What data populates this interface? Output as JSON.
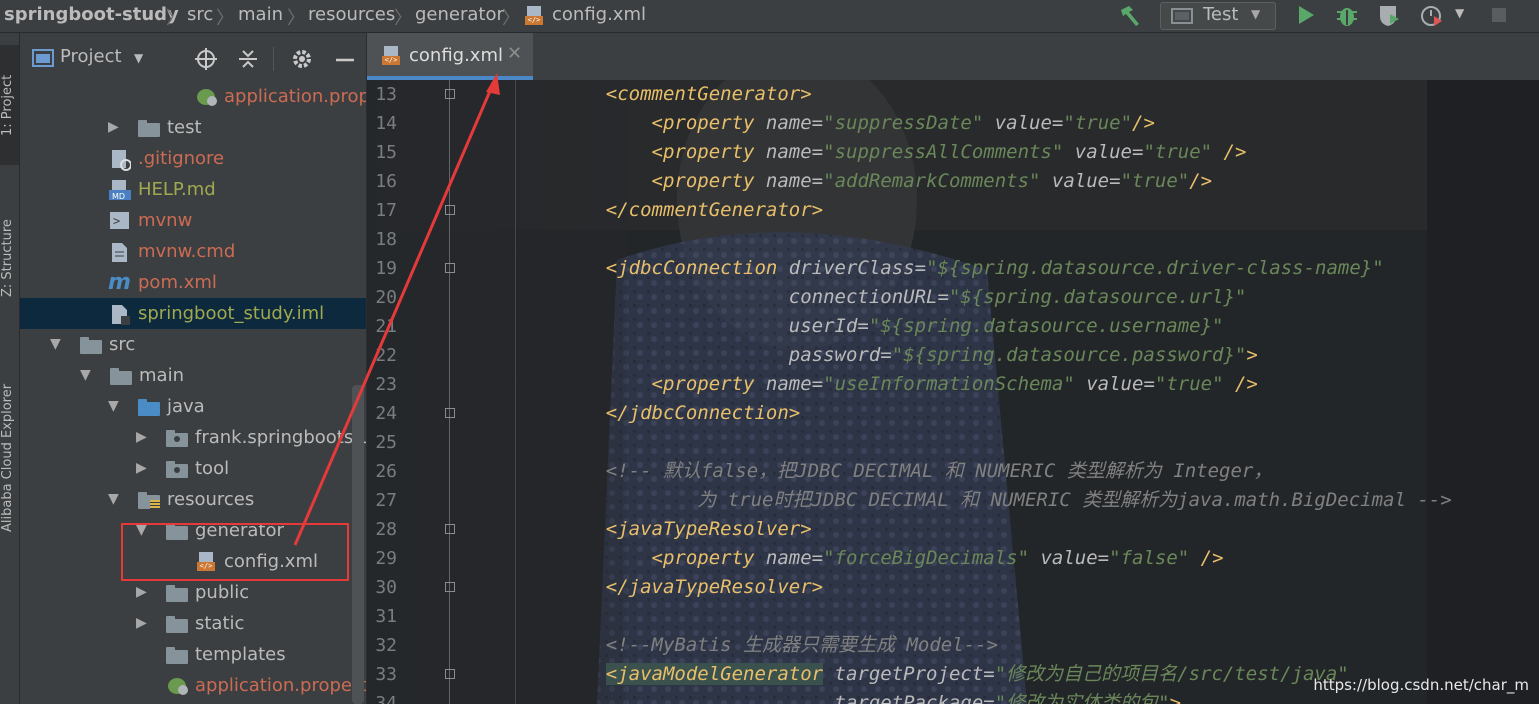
{
  "breadcrumb": {
    "items": [
      "springboot-study",
      "src",
      "main",
      "resources",
      "generator",
      "config.xml"
    ]
  },
  "toolbar": {
    "run_config_label": "Test",
    "icons": [
      "build-hammer-icon",
      "run-icon",
      "debug-icon",
      "coverage-icon",
      "profile-icon",
      "stop-icon"
    ]
  },
  "left_strip": {
    "tabs": [
      "1: Project",
      "Z: Structure",
      "Alibaba Cloud Explorer"
    ]
  },
  "project_panel": {
    "title": "Project",
    "tree": [
      {
        "label": "application.prope",
        "icon": "spring-properties-icon",
        "color": "#cc6b53"
      },
      {
        "label": "test",
        "icon": "folder-icon",
        "color": "#bbbbbb",
        "arrow": "▶"
      },
      {
        "label": ".gitignore",
        "icon": "file-ignore-icon",
        "color": "#cc6b53"
      },
      {
        "label": "HELP.md",
        "icon": "markdown-icon",
        "color": "#a0a94f"
      },
      {
        "label": "mvnw",
        "icon": "shell-script-icon",
        "color": "#cc6b53"
      },
      {
        "label": "mvnw.cmd",
        "icon": "file-icon",
        "color": "#cc6b53"
      },
      {
        "label": "pom.xml",
        "icon": "maven-icon",
        "color": "#cc6b53"
      },
      {
        "label": "springboot_study.iml",
        "icon": "iml-file-icon",
        "color": "#a0a94f"
      },
      {
        "label": "src",
        "icon": "folder-icon",
        "color": "#bbbbbb",
        "arrow": "▼"
      },
      {
        "label": "main",
        "icon": "folder-icon",
        "color": "#bbbbbb",
        "arrow": "▼"
      },
      {
        "label": "java",
        "icon": "source-folder-icon",
        "color": "#bbbbbb",
        "arrow": "▼"
      },
      {
        "label": "frank.springbootstuc",
        "icon": "package-icon",
        "color": "#bbbbbb",
        "arrow": "▶"
      },
      {
        "label": "tool",
        "icon": "package-icon",
        "color": "#bbbbbb",
        "arrow": "▶"
      },
      {
        "label": "resources",
        "icon": "resources-folder-icon",
        "color": "#bbbbbb",
        "arrow": "▼"
      },
      {
        "label": "generator",
        "icon": "folder-icon",
        "color": "#bbbbbb",
        "arrow": "▼"
      },
      {
        "label": "config.xml",
        "icon": "xml-file-icon",
        "color": "#bbbbbb"
      },
      {
        "label": "public",
        "icon": "folder-icon",
        "color": "#bbbbbb",
        "arrow": "▶"
      },
      {
        "label": "static",
        "icon": "folder-icon",
        "color": "#bbbbbb",
        "arrow": "▶"
      },
      {
        "label": "templates",
        "icon": "folder-icon",
        "color": "#bbbbbb"
      },
      {
        "label": "application.propertie",
        "icon": "spring-properties-icon",
        "color": "#cc6b53"
      }
    ]
  },
  "editor": {
    "tab_label": "config.xml",
    "lines": [
      {
        "n": "13",
        "segs": [
          [
            "    ",
            ""
          ],
          [
            "<commentGenerator>",
            "tag"
          ]
        ]
      },
      {
        "n": "14",
        "segs": [
          [
            "        ",
            ""
          ],
          [
            "<property ",
            "tag"
          ],
          [
            "name",
            "attr"
          ],
          [
            "=",
            "eq"
          ],
          [
            "\"suppressDate\"",
            "val"
          ],
          [
            " value",
            "attr"
          ],
          [
            "=",
            "eq"
          ],
          [
            "\"true\"",
            "val"
          ],
          [
            "/>",
            "tag"
          ]
        ]
      },
      {
        "n": "15",
        "segs": [
          [
            "        ",
            ""
          ],
          [
            "<property ",
            "tag"
          ],
          [
            "name",
            "attr"
          ],
          [
            "=",
            "eq"
          ],
          [
            "\"suppressAllComments\"",
            "val"
          ],
          [
            " value",
            "attr"
          ],
          [
            "=",
            "eq"
          ],
          [
            "\"true\"",
            "val"
          ],
          [
            " />",
            "tag"
          ]
        ]
      },
      {
        "n": "16",
        "segs": [
          [
            "        ",
            ""
          ],
          [
            "<property ",
            "tag"
          ],
          [
            "name",
            "attr"
          ],
          [
            "=",
            "eq"
          ],
          [
            "\"addRemarkComments\"",
            "val"
          ],
          [
            " value",
            "attr"
          ],
          [
            "=",
            "eq"
          ],
          [
            "\"true\"",
            "val"
          ],
          [
            "/>",
            "tag"
          ]
        ]
      },
      {
        "n": "17",
        "segs": [
          [
            "    ",
            ""
          ],
          [
            "</commentGenerator>",
            "tag"
          ]
        ]
      },
      {
        "n": "18",
        "segs": [
          [
            "",
            ""
          ]
        ]
      },
      {
        "n": "19",
        "segs": [
          [
            "    ",
            ""
          ],
          [
            "<jdbcConnection ",
            "tag"
          ],
          [
            "driverClass",
            "attr"
          ],
          [
            "=",
            "eq"
          ],
          [
            "\"${spring.datasource.driver-class-name}\"",
            "val"
          ]
        ]
      },
      {
        "n": "20",
        "segs": [
          [
            "                    ",
            ""
          ],
          [
            "connectionURL",
            "attr"
          ],
          [
            "=",
            "eq"
          ],
          [
            "\"${spring.datasource.url}\"",
            "val"
          ]
        ]
      },
      {
        "n": "21",
        "segs": [
          [
            "                    ",
            ""
          ],
          [
            "userId",
            "attr"
          ],
          [
            "=",
            "eq"
          ],
          [
            "\"${spring.datasource.username}\"",
            "val"
          ]
        ]
      },
      {
        "n": "22",
        "segs": [
          [
            "                    ",
            ""
          ],
          [
            "password",
            "attr"
          ],
          [
            "=",
            "eq"
          ],
          [
            "\"${spring.datasource.password}\"",
            "val"
          ],
          [
            ">",
            "tag"
          ]
        ]
      },
      {
        "n": "23",
        "segs": [
          [
            "        ",
            ""
          ],
          [
            "<property ",
            "tag"
          ],
          [
            "name",
            "attr"
          ],
          [
            "=",
            "eq"
          ],
          [
            "\"useInformationSchema\"",
            "val"
          ],
          [
            " value",
            "attr"
          ],
          [
            "=",
            "eq"
          ],
          [
            "\"true\"",
            "val"
          ],
          [
            " />",
            "tag"
          ]
        ]
      },
      {
        "n": "24",
        "segs": [
          [
            "    ",
            ""
          ],
          [
            "</jdbcConnection>",
            "tag"
          ]
        ]
      },
      {
        "n": "25",
        "segs": [
          [
            "",
            ""
          ]
        ]
      },
      {
        "n": "26",
        "segs": [
          [
            "    ",
            ""
          ],
          [
            "<!-- 默认false，把JDBC DECIMAL 和 NUMERIC 类型解析为 Integer，",
            "cmt"
          ]
        ]
      },
      {
        "n": "27",
        "segs": [
          [
            "            ",
            ""
          ],
          [
            "为 true时把JDBC DECIMAL 和 NUMERIC 类型解析为java.math.BigDecimal -->",
            "cmt"
          ]
        ]
      },
      {
        "n": "28",
        "segs": [
          [
            "    ",
            ""
          ],
          [
            "<javaTypeResolver>",
            "tag"
          ]
        ]
      },
      {
        "n": "29",
        "segs": [
          [
            "        ",
            ""
          ],
          [
            "<property ",
            "tag"
          ],
          [
            "name",
            "attr"
          ],
          [
            "=",
            "eq"
          ],
          [
            "\"forceBigDecimals\"",
            "val"
          ],
          [
            " value",
            "attr"
          ],
          [
            "=",
            "eq"
          ],
          [
            "\"false\"",
            "val"
          ],
          [
            " />",
            "tag"
          ]
        ]
      },
      {
        "n": "30",
        "segs": [
          [
            "    ",
            ""
          ],
          [
            "</javaTypeResolver>",
            "tag"
          ]
        ]
      },
      {
        "n": "31",
        "segs": [
          [
            "",
            ""
          ]
        ]
      },
      {
        "n": "32",
        "segs": [
          [
            "    ",
            ""
          ],
          [
            "<!--MyBatis 生成器只需要生成 Model-->",
            "cmt"
          ]
        ]
      },
      {
        "n": "33",
        "segs": [
          [
            "    ",
            ""
          ],
          [
            "<javaModelGenerator",
            "tag hl"
          ],
          [
            " targetProject",
            "attr"
          ],
          [
            "=",
            "eq"
          ],
          [
            "\"修改为自己的项目名/src/test/java\"",
            "val"
          ]
        ]
      },
      {
        "n": "34",
        "segs": [
          [
            "                        ",
            ""
          ],
          [
            "targetPackage",
            "attr"
          ],
          [
            "=",
            "eq"
          ],
          [
            "\"修改为实体类的包\"",
            "val"
          ],
          [
            ">",
            "tag"
          ]
        ]
      }
    ]
  },
  "watermark": "https://blog.csdn.net/char_m"
}
